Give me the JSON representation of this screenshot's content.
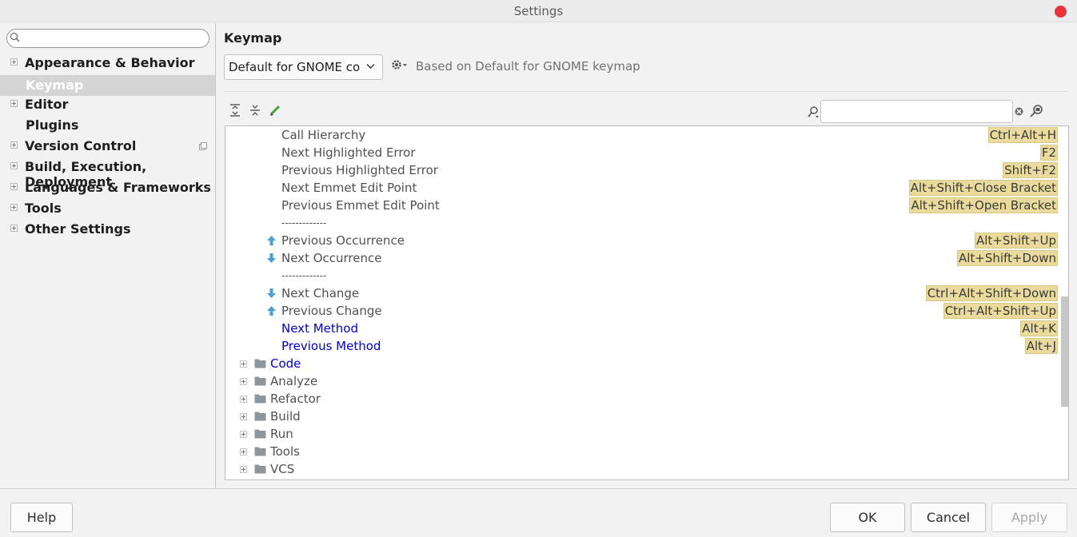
{
  "window": {
    "title": "Settings"
  },
  "sidebar": {
    "search_placeholder": "",
    "items": [
      {
        "label": "Appearance & Behavior",
        "expandable": true
      },
      {
        "label": "Keymap",
        "expandable": false,
        "selected": true
      },
      {
        "label": "Editor",
        "expandable": true
      },
      {
        "label": "Plugins",
        "expandable": false
      },
      {
        "label": "Version Control",
        "expandable": true
      },
      {
        "label": "Build, Execution, Deployment",
        "expandable": true
      },
      {
        "label": "Languages & Frameworks",
        "expandable": true
      },
      {
        "label": "Tools",
        "expandable": true
      },
      {
        "label": "Other Settings",
        "expandable": true
      }
    ]
  },
  "main": {
    "title": "Keymap",
    "keymap_select": {
      "value": "Default for GNOME co"
    },
    "based_on": "Based on Default for GNOME keymap",
    "filter_value": "",
    "actions": [
      {
        "name": "Call Hierarchy",
        "shortcut": "Ctrl+Alt+H"
      },
      {
        "name": "Next Highlighted Error",
        "shortcut": "F2"
      },
      {
        "name": "Previous Highlighted Error",
        "shortcut": "Shift+F2"
      },
      {
        "name": "Next Emmet Edit Point",
        "shortcut": "Alt+Shift+Close Bracket"
      },
      {
        "name": "Previous Emmet Edit Point",
        "shortcut": "Alt+Shift+Open Bracket"
      },
      {
        "name": "-------------",
        "shortcut": ""
      },
      {
        "name": "Previous Occurrence",
        "shortcut": "Alt+Shift+Up",
        "icon": "arrow-up-icon"
      },
      {
        "name": "Next Occurrence",
        "shortcut": "Alt+Shift+Down",
        "icon": "arrow-down-icon"
      },
      {
        "name": "-------------",
        "shortcut": ""
      },
      {
        "name": "Next Change",
        "shortcut": "Ctrl+Alt+Shift+Down",
        "icon": "arrow-down-icon"
      },
      {
        "name": "Previous Change",
        "shortcut": "Ctrl+Alt+Shift+Up",
        "icon": "arrow-up-icon"
      },
      {
        "name": "Next Method",
        "shortcut": "Alt+K",
        "modified": true
      },
      {
        "name": "Previous Method",
        "shortcut": "Alt+J",
        "modified": true
      }
    ],
    "groups": [
      {
        "name": "Code",
        "modified": true
      },
      {
        "name": "Analyze"
      },
      {
        "name": "Refactor"
      },
      {
        "name": "Build"
      },
      {
        "name": "Run"
      },
      {
        "name": "Tools"
      },
      {
        "name": "VCS"
      }
    ]
  },
  "footer": {
    "help": "Help",
    "ok": "OK",
    "cancel": "Cancel",
    "apply": "Apply"
  },
  "colors": {
    "shortcut_bg": "#eadb9c",
    "link": "#0000cc",
    "close": "#e8343b",
    "arrow": "#4a9fd4"
  }
}
